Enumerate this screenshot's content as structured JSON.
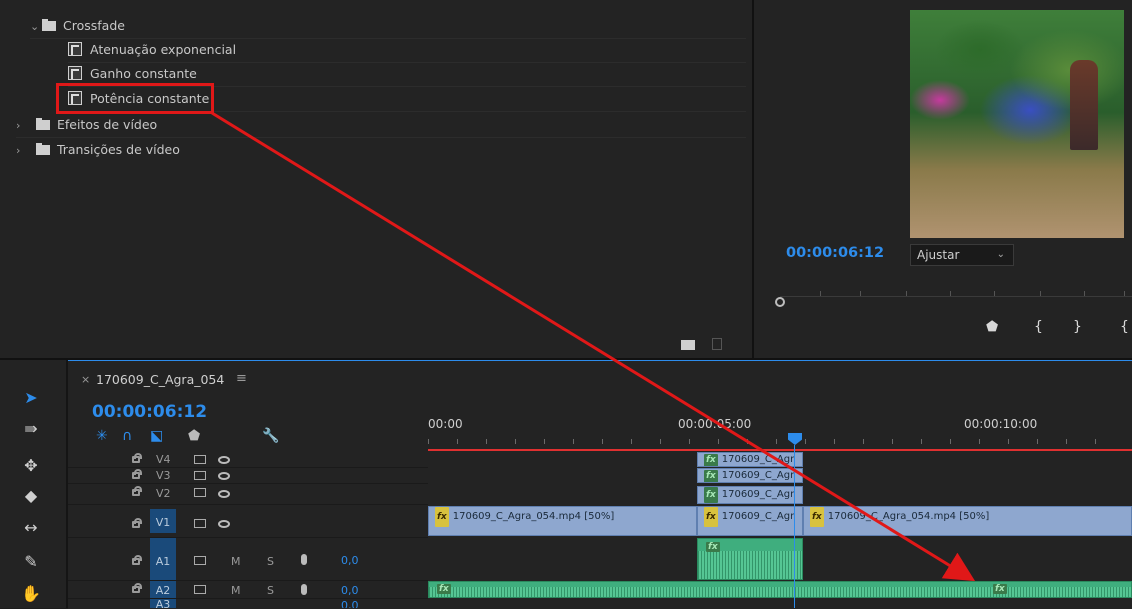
{
  "effects_panel": {
    "items": [
      {
        "label": "Crossfade",
        "kind": "folder",
        "expanded": true
      },
      {
        "label": "Atenuação exponencial",
        "kind": "effect"
      },
      {
        "label": "Ganho constante",
        "kind": "effect"
      },
      {
        "label": "Potência constante",
        "kind": "effect",
        "highlighted": true
      },
      {
        "label": "Efeitos de vídeo",
        "kind": "folder",
        "expanded": false
      },
      {
        "label": "Transições de vídeo",
        "kind": "folder",
        "expanded": false
      }
    ],
    "icons": [
      "new-bin-icon",
      "trash-icon"
    ]
  },
  "program_monitor": {
    "timecode": "00:00:06:12",
    "fit_select": "Ajustar",
    "transport_icons": [
      "add-marker-icon",
      "mark-in-icon",
      "mark-out-icon",
      "go-to-in-icon"
    ]
  },
  "timeline": {
    "tab_close": "×",
    "sequence_name": "170609_C_Agra_054",
    "menu_icon": "≡",
    "timecode": "00:00:06:12",
    "ruler": [
      "00:00",
      "00:00:05:00",
      "00:00:10:00"
    ],
    "tracks": {
      "V4": "V4",
      "V3": "V3",
      "V2": "V2",
      "V1": "V1",
      "A1": "A1",
      "A2": "A2",
      "A3": "A3"
    },
    "audio_controls": {
      "m": "M",
      "s": "S",
      "a1_vol": "0,0",
      "a2_vol": "0,0",
      "a3_vol": "0,0"
    },
    "clips": {
      "v4": "170609_C_Agr",
      "v3": "170609_C_Agr",
      "v2": "170609_C_Agr",
      "v1_a": "170609_C_Agra_054.mp4 [50%]",
      "v1_b": "170609_C_Agr",
      "v1_c": "170609_C_Agra_054.mp4 [50%]",
      "fx": "fx"
    }
  },
  "colors": {
    "accent": "#2d8ceb",
    "annotation": "#e01818",
    "audio_clip": "#3fae7e",
    "video_clip": "#8ea7cf"
  }
}
